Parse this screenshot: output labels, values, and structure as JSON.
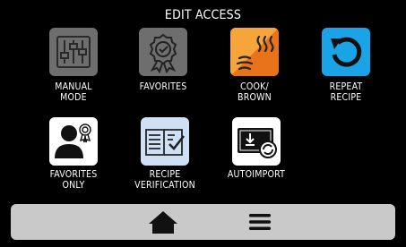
{
  "screen": {
    "title": "EDIT ACCESS"
  },
  "tiles": [
    {
      "id": "manual-mode",
      "label": "MANUAL\nMODE",
      "icon": "sliders-icon",
      "color": "#6e6e6e"
    },
    {
      "id": "favorites",
      "label": "FAVORITES",
      "icon": "award-ribbon-icon",
      "color": "#6e6e6e"
    },
    {
      "id": "cook-brown",
      "label": "COOK/\nBROWN",
      "icon": "cook-brown-icon",
      "color": "#f39b2b"
    },
    {
      "id": "repeat-recipe",
      "label": "REPEAT\nRECIPE",
      "icon": "repeat-icon",
      "color": "#1aa3e6"
    },
    {
      "id": "favorites-only",
      "label": "FAVORITES\nONLY",
      "icon": "user-award-icon",
      "color": "#ffffff"
    },
    {
      "id": "recipe-verification",
      "label": "RECIPE\nVERIFICATION",
      "icon": "book-check-icon",
      "color": "#cfe0f5"
    },
    {
      "id": "autoimport",
      "label": "AUTOIMPORT",
      "icon": "import-icon",
      "color": "#ffffff"
    }
  ],
  "nav": {
    "home_icon": "home-icon",
    "menu_icon": "menu-icon",
    "bar_color": "#c9c9c9"
  }
}
